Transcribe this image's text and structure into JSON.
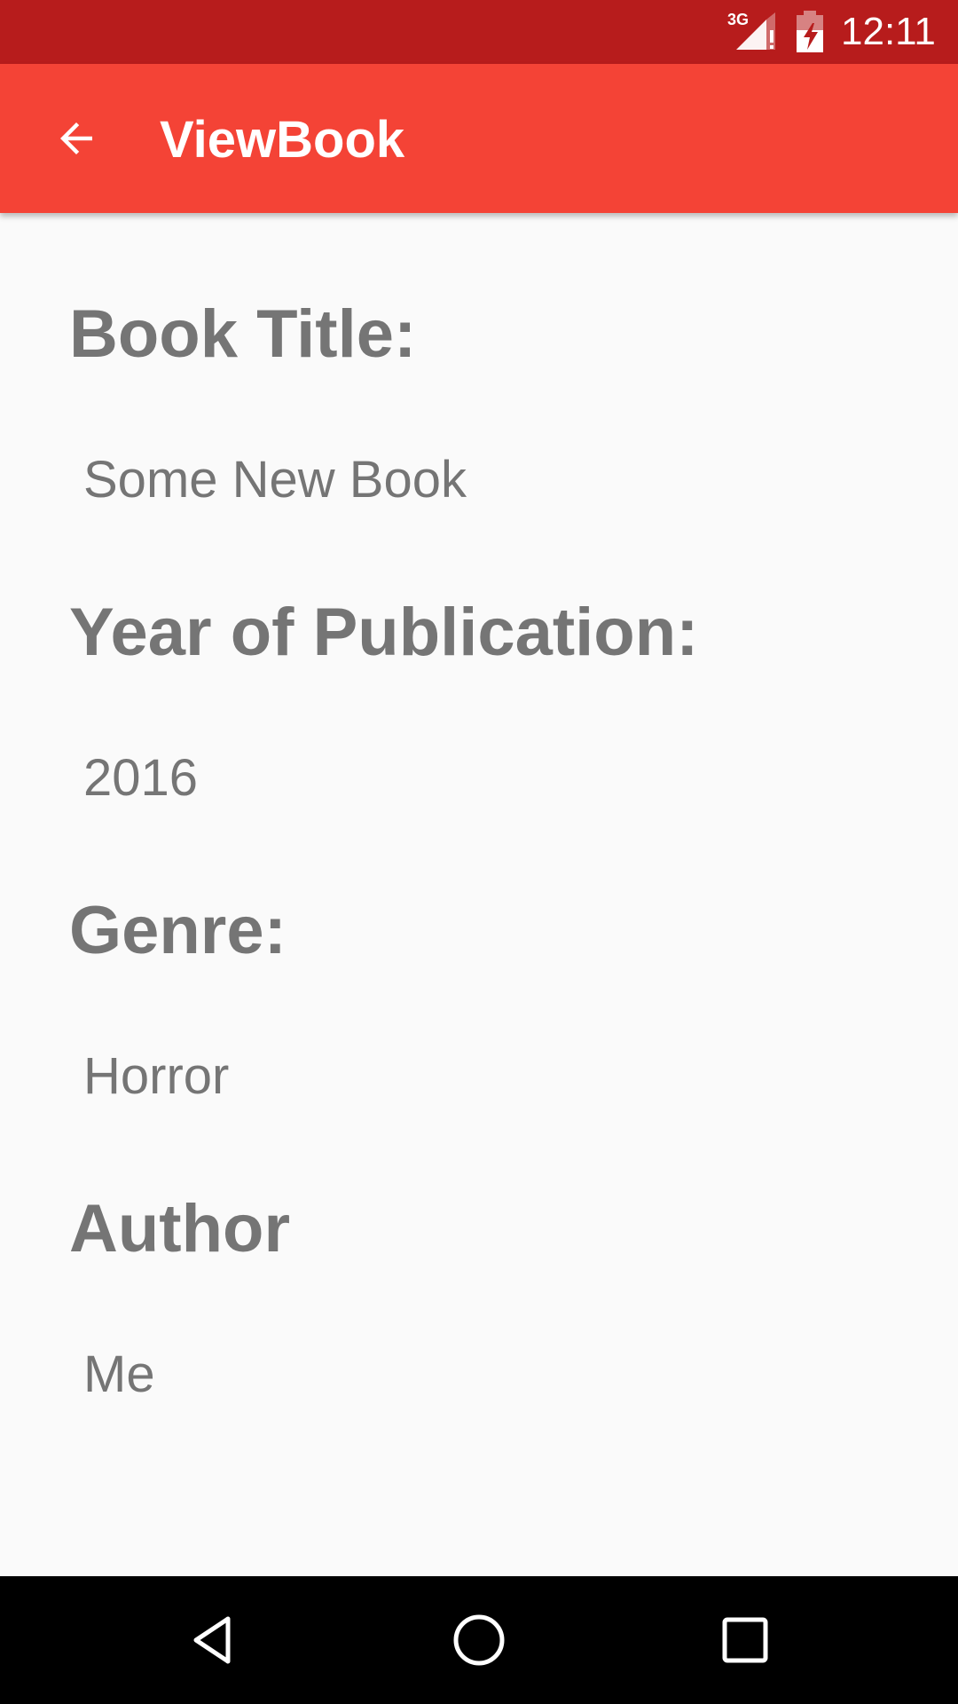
{
  "status_bar": {
    "network_label": "3G",
    "time": "12:11",
    "icons": [
      "signal-icon",
      "battery-charging-icon"
    ],
    "background_color": "#B71C1C"
  },
  "app_bar": {
    "title": "ViewBook",
    "back_icon": "arrow-back-icon",
    "background_color": "#F44336"
  },
  "fields": [
    {
      "label": "Book Title:",
      "value": "Some New Book"
    },
    {
      "label": "Year of Publication:",
      "value": "2016"
    },
    {
      "label": "Genre:",
      "value": "Horror"
    },
    {
      "label": "Author",
      "value": "Me"
    }
  ],
  "nav_bar": {
    "buttons": [
      "back-triangle-icon",
      "home-circle-icon",
      "recents-square-icon"
    ]
  }
}
